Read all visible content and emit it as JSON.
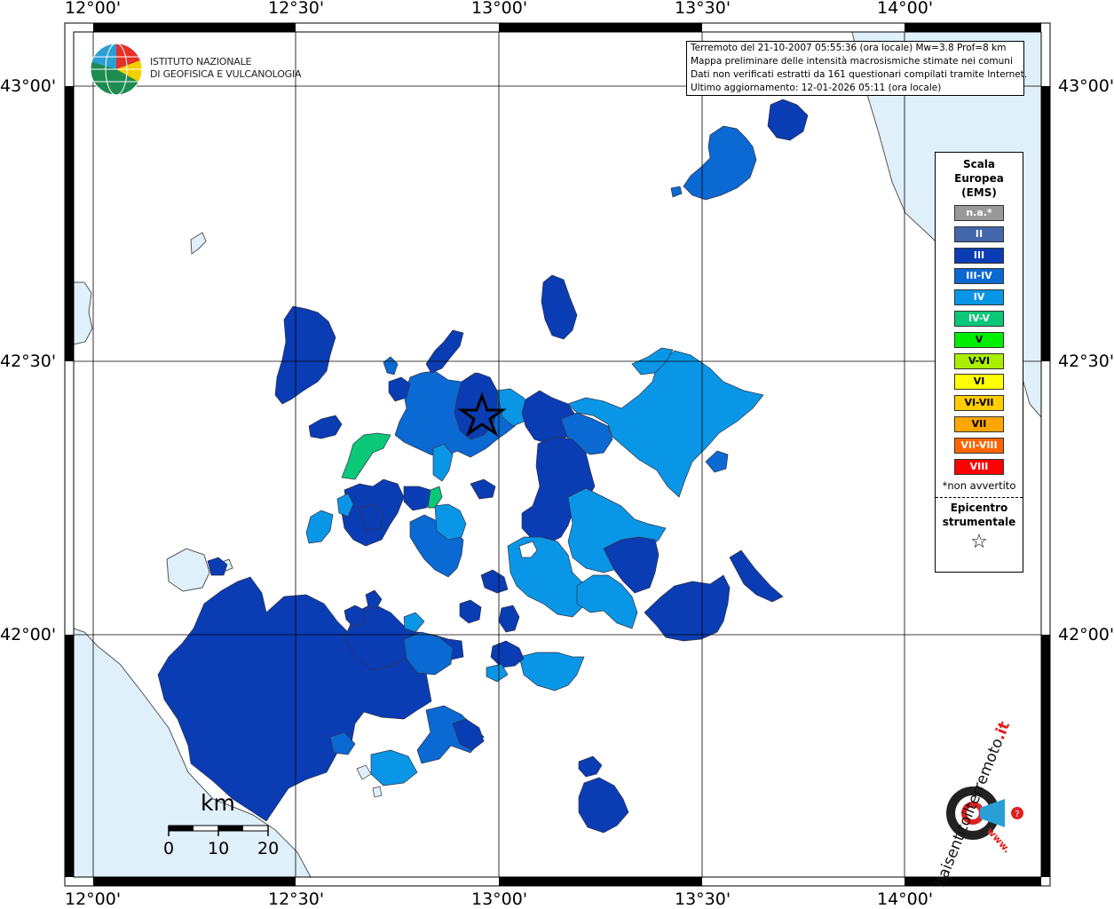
{
  "map": {
    "lon_labels": [
      "12°00'",
      "12°30'",
      "13°00'",
      "13°30'",
      "14°00'"
    ],
    "lat_labels": [
      "43°00'",
      "42°30'",
      "42°00'"
    ],
    "sea_color": "#dff0fb",
    "land_color": "#ffffff"
  },
  "info_box": {
    "line1": "Terremoto del 21-10-2007 05:55:36 (ora locale) Mw=3.8 Prof=8 km",
    "line2": "Mappa preliminare delle intensità macrosismiche stimate nei comuni",
    "line3": "Dati non verificati estratti da 161 questionari compilati tramite Internet.",
    "line4": "Ultimo aggiornamento: 12-01-2026 05:11 (ora locale)"
  },
  "institute": {
    "name_line1": "ISTITUTO NAZIONALE",
    "name_line2": "DI GEOFISICA E VULCANOLOGIA"
  },
  "legend": {
    "title_line1": "Scala",
    "title_line2": "Europea",
    "title_line3": "(EMS)",
    "items": [
      {
        "label": "n.a.*",
        "color": "#999999"
      },
      {
        "label": "II",
        "color": "#4466aa"
      },
      {
        "label": "III",
        "color": "#0a3cb4"
      },
      {
        "label": "III-IV",
        "color": "#0a69d2"
      },
      {
        "label": "IV",
        "color": "#0a96e6"
      },
      {
        "label": "IV-V",
        "color": "#0ac878"
      },
      {
        "label": "V",
        "color": "#00ee00"
      },
      {
        "label": "V-VI",
        "color": "#aaee00"
      },
      {
        "label": "VI",
        "color": "#ffff00"
      },
      {
        "label": "VI-VII",
        "color": "#ffcc00"
      },
      {
        "label": "VII",
        "color": "#ffa500"
      },
      {
        "label": "VII-VIII",
        "color": "#ff6400"
      },
      {
        "label": "VIII",
        "color": "#ff0000"
      }
    ],
    "note": "*non avvertito",
    "epicenter_line1": "Epicentro",
    "epicenter_line2": "strumentale",
    "epicenter_symbol": "☆"
  },
  "scale_bar": {
    "unit": "km",
    "labels": [
      "0",
      "10",
      "20"
    ]
  },
  "website_logo": {
    "text_main": "haisentitoilterremoto",
    "text_tld": ".it",
    "text_www": "www."
  }
}
